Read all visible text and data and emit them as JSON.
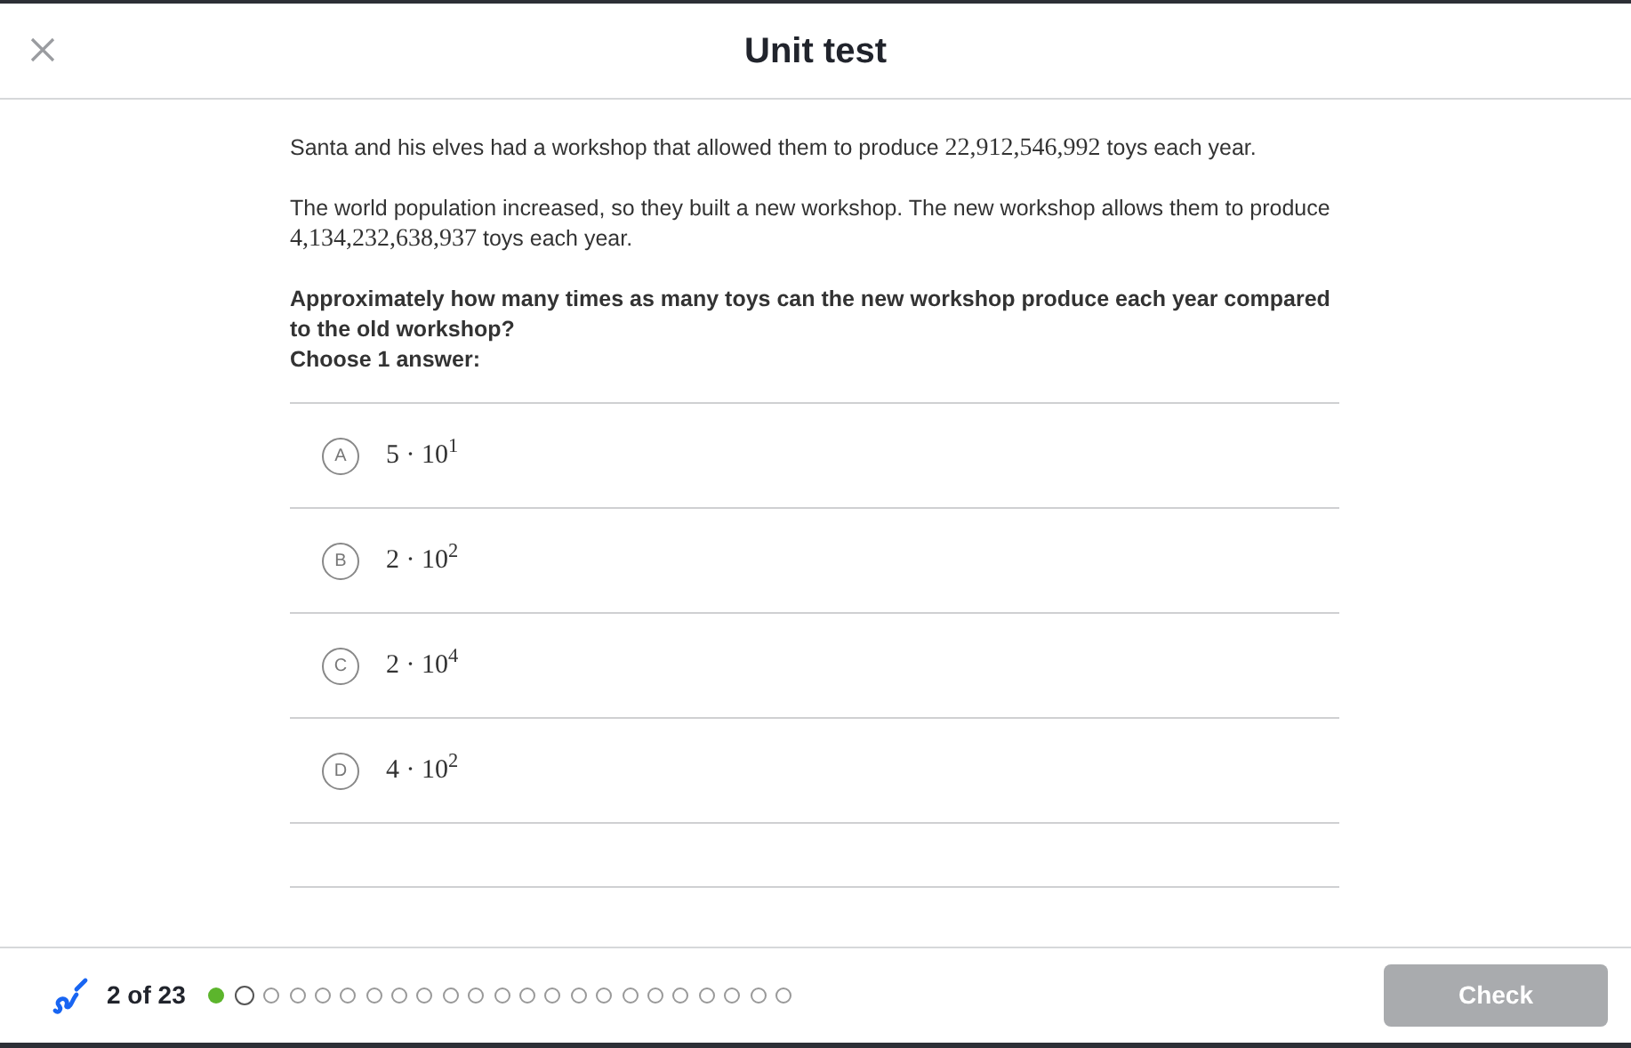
{
  "header": {
    "title": "Unit test"
  },
  "question": {
    "paragraphs": [
      [
        {
          "kind": "text",
          "text": "Santa and his elves had a workshop that allowed them to produce "
        },
        {
          "kind": "math",
          "text": "22,912,546,992"
        },
        {
          "kind": "text",
          "text": " toys each year."
        }
      ],
      [
        {
          "kind": "text",
          "text": "The world population increased, so they built a new workshop. The new workshop allows them to produce "
        },
        {
          "kind": "math",
          "text": "4,134,232,638,937"
        },
        {
          "kind": "text",
          "text": " toys each year."
        }
      ]
    ],
    "prompt": "Approximately how many times as many toys can the new workshop produce each year compared to the old workshop?",
    "instruction": "Choose 1 answer:",
    "choices": [
      {
        "letter": "A",
        "answer": "5 · 10$^{1}$",
        "selected": false
      },
      {
        "letter": "B",
        "answer": "2 · 10$^{2}$",
        "selected": false
      },
      {
        "letter": "C",
        "answer": "2 · 10$^{4}$",
        "selected": false
      },
      {
        "letter": "D",
        "answer": "4 · 10$^{2}$",
        "selected": false
      }
    ]
  },
  "footer": {
    "progress": "2 of 23",
    "steps": [
      {
        "completed": true,
        "selected": false
      },
      {
        "completed": false,
        "selected": true
      },
      {
        "completed": false,
        "selected": false
      },
      {
        "completed": false,
        "selected": false
      },
      {
        "completed": false,
        "selected": false
      },
      {
        "completed": false,
        "selected": false
      },
      {
        "completed": false,
        "selected": false
      },
      {
        "completed": false,
        "selected": false
      },
      {
        "completed": false,
        "selected": false
      },
      {
        "completed": false,
        "selected": false
      },
      {
        "completed": false,
        "selected": false
      },
      {
        "completed": false,
        "selected": false
      },
      {
        "completed": false,
        "selected": false
      },
      {
        "completed": false,
        "selected": false
      },
      {
        "completed": false,
        "selected": false
      },
      {
        "completed": false,
        "selected": false
      },
      {
        "completed": false,
        "selected": false
      },
      {
        "completed": false,
        "selected": false
      },
      {
        "completed": false,
        "selected": false
      },
      {
        "completed": false,
        "selected": false
      },
      {
        "completed": false,
        "selected": false
      },
      {
        "completed": false,
        "selected": false
      },
      {
        "completed": false,
        "selected": false
      }
    ],
    "check_button": {
      "label": "Check",
      "disabled": true
    }
  }
}
